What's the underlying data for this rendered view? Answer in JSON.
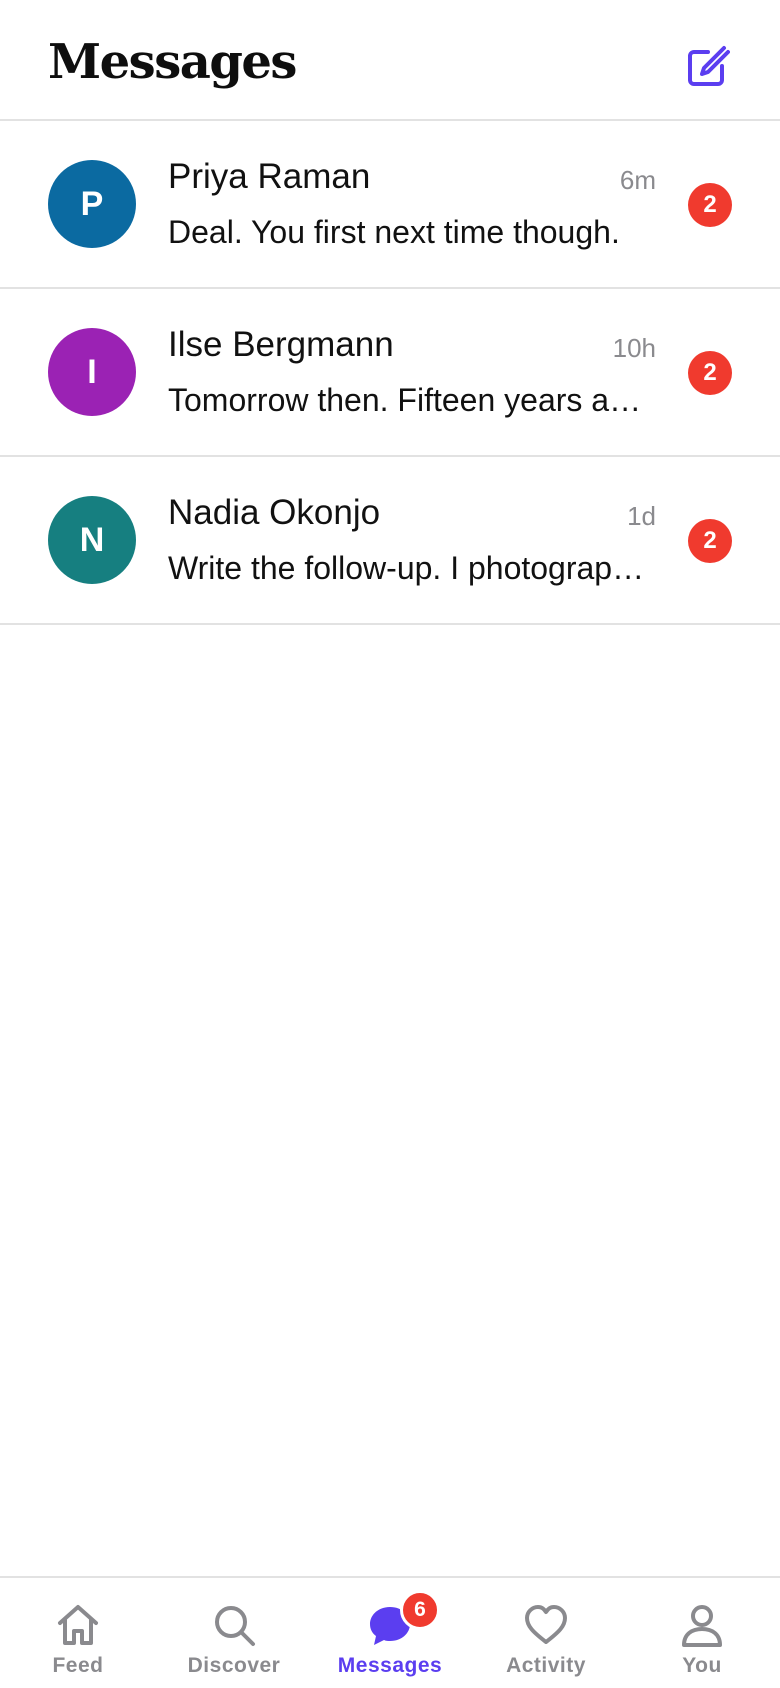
{
  "header": {
    "title": "Messages",
    "compose_icon": "compose-icon"
  },
  "colors": {
    "accent": "#5b3ef0",
    "badge": "#f03a2e",
    "muted": "#8a8a8e"
  },
  "conversations": [
    {
      "initial": "P",
      "name": "Priya Raman",
      "time": "6m",
      "preview": "Deal. You first next time though.",
      "unread": "2",
      "avatar_color": "#0b6aa1"
    },
    {
      "initial": "I",
      "name": "Ilse Bergmann",
      "time": "10h",
      "preview": "Tomorrow then. Fifteen years ago we stood on that same bridge.",
      "unread": "2",
      "avatar_color": "#9b22b4"
    },
    {
      "initial": "N",
      "name": "Nadia Okonjo",
      "time": "1d",
      "preview": "Write the follow-up. I photographed every page of the ledger.",
      "unread": "2",
      "avatar_color": "#167f80"
    }
  ],
  "tabbar": {
    "tabs": [
      {
        "label": "Feed",
        "icon": "home-icon"
      },
      {
        "label": "Discover",
        "icon": "search-icon"
      },
      {
        "label": "Messages",
        "icon": "chat-bubble-icon",
        "badge": "6",
        "active": true
      },
      {
        "label": "Activity",
        "icon": "heart-icon"
      },
      {
        "label": "You",
        "icon": "person-icon"
      }
    ]
  }
}
